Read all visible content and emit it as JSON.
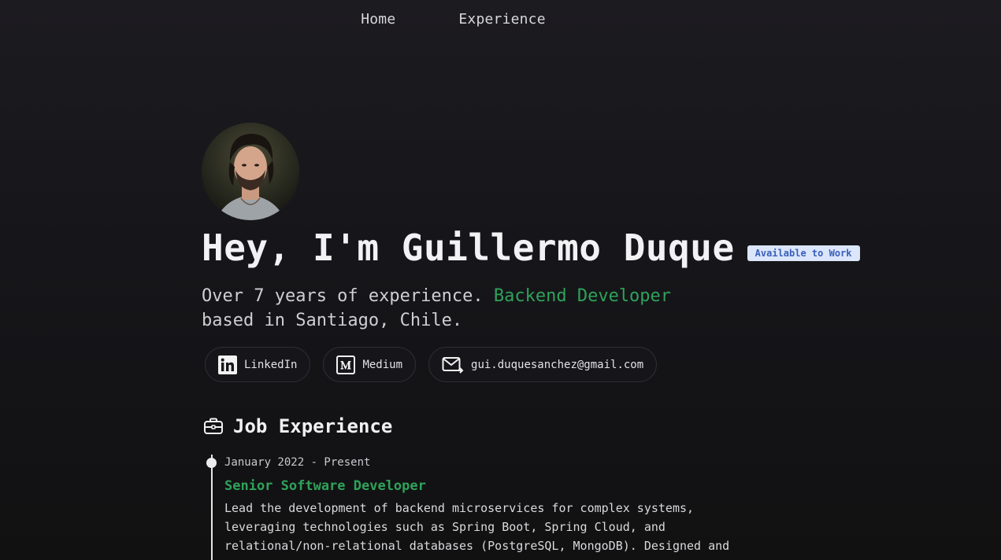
{
  "nav": {
    "home": "Home",
    "experience": "Experience"
  },
  "hero": {
    "title": "Hey, I'm Guillermo Duque",
    "badge": "Available to Work",
    "intro_before": "Over 7 years of experience.",
    "intro_accent": "Backend Developer",
    "intro_after": "based in Santiago, Chile."
  },
  "socials": [
    {
      "label": "LinkedIn",
      "icon": "linkedin-icon"
    },
    {
      "label": "Medium",
      "icon": "medium-icon"
    },
    {
      "label": "gui.duquesanchez@gmail.com",
      "icon": "mail-icon"
    }
  ],
  "experience": {
    "heading": "Job Experience",
    "jobs": [
      {
        "date": "January 2022 - Present",
        "role": "Senior Software Developer",
        "desc_lines": [
          "Lead the development of backend microservices for complex systems,",
          "leveraging technologies such as Spring Boot, Spring Cloud, and",
          "relational/non-relational databases (PostgreSQL, MongoDB). Designed and"
        ]
      }
    ]
  },
  "colors": {
    "accent_green": "#2fa25a",
    "badge_bg": "#dbe6fb",
    "badge_text": "#3a5fb8"
  }
}
